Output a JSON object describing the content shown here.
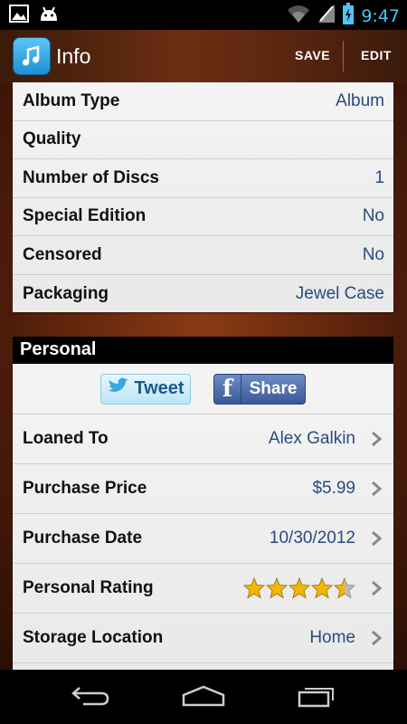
{
  "status": {
    "time": "9:47",
    "left_icons": [
      "gallery-icon",
      "android-icon"
    ],
    "right_icons": [
      "wifi-icon",
      "signal-icon",
      "battery-icon"
    ]
  },
  "actionbar": {
    "title": "Info",
    "save_label": "SAVE",
    "edit_label": "EDIT"
  },
  "details": [
    {
      "label": "Album Type",
      "value": "Album"
    },
    {
      "label": "Quality",
      "value": ""
    },
    {
      "label": "Number of Discs",
      "value": "1"
    },
    {
      "label": "Special Edition",
      "value": "No"
    },
    {
      "label": "Censored",
      "value": "No"
    },
    {
      "label": "Packaging",
      "value": "Jewel Case"
    }
  ],
  "personal": {
    "header": "Personal",
    "tweet_label": "Tweet",
    "share_label": "Share",
    "rows": [
      {
        "label": "Loaned To",
        "value": "Alex Galkin"
      },
      {
        "label": "Purchase Price",
        "value": "$5.99"
      },
      {
        "label": "Purchase Date",
        "value": "10/30/2012"
      },
      {
        "label": "Personal Rating",
        "rating": 4.5,
        "rating_max": 5
      },
      {
        "label": "Storage Location",
        "value": "Home"
      }
    ]
  },
  "colors": {
    "accent": "#4fc3f7",
    "value_text": "#2a4a7e",
    "star": "#f2b705"
  }
}
